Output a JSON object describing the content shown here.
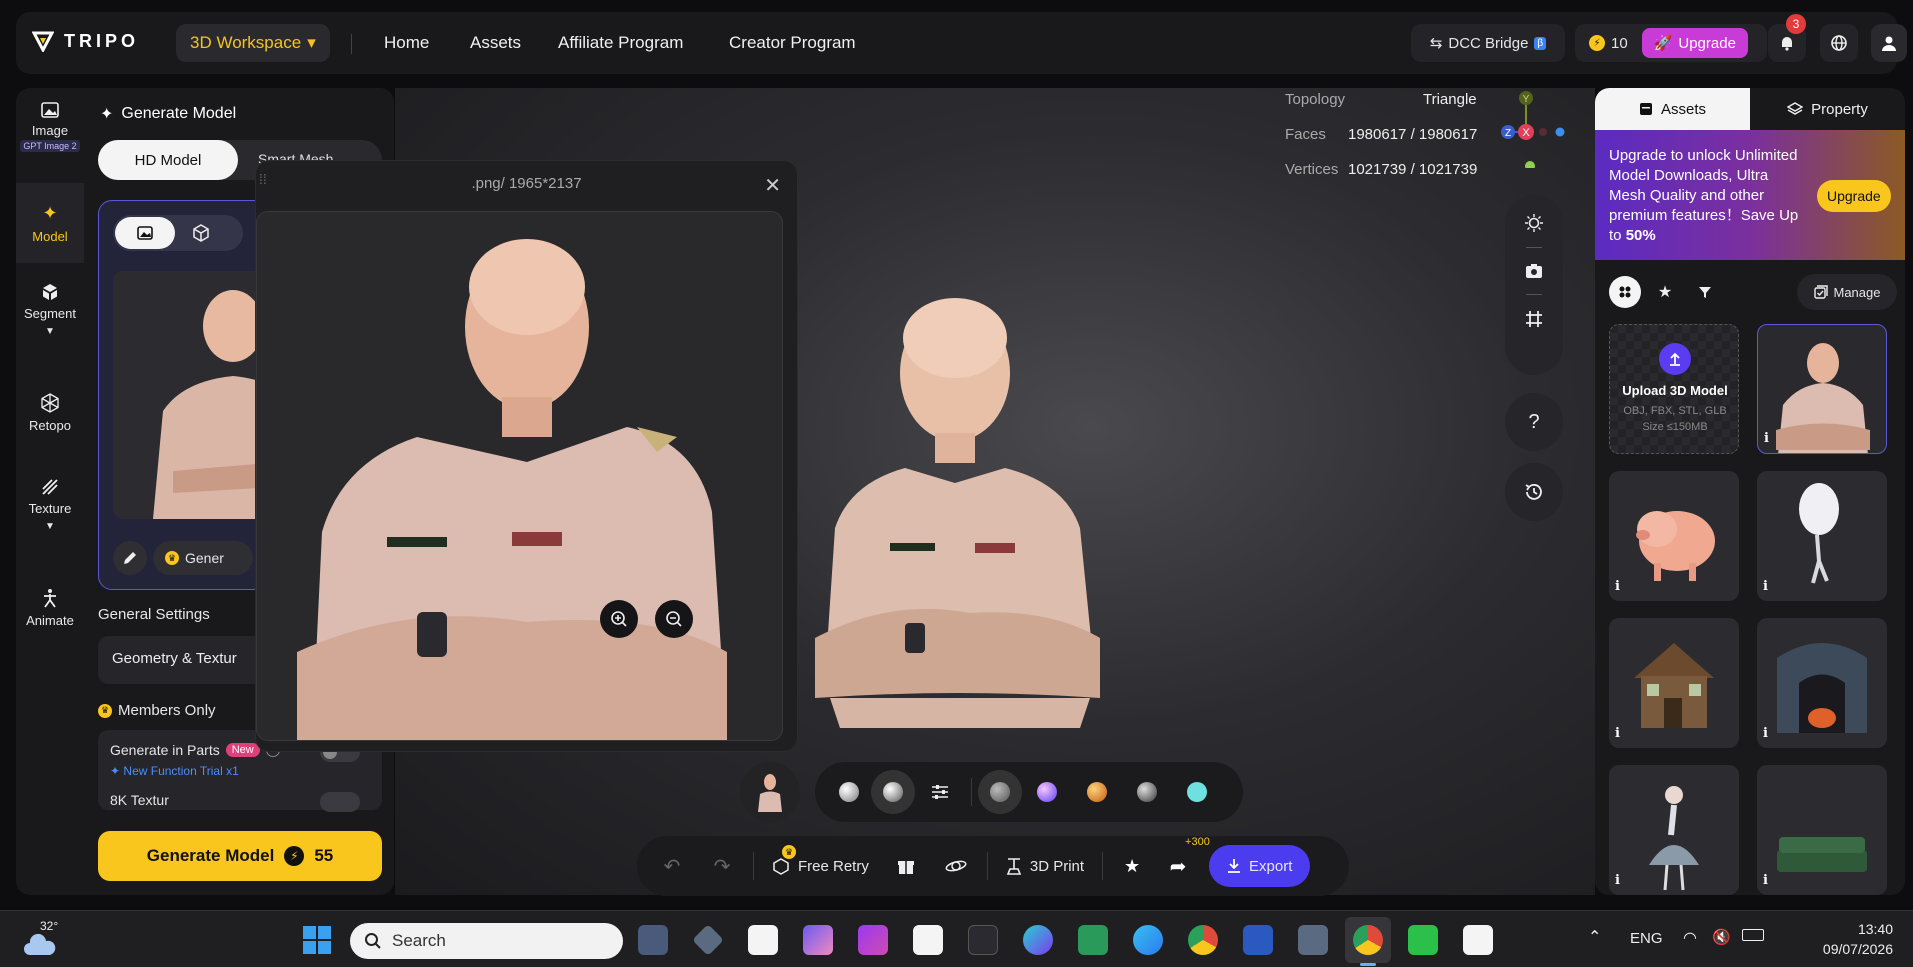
{
  "topbar": {
    "brand": "TRIPO",
    "workspace": "3D Workspace",
    "nav": [
      "Home",
      "Assets",
      "Affiliate Program",
      "Creator Program"
    ],
    "dcc_bridge": "DCC Bridge",
    "dcc_badge": "β",
    "credits": "10",
    "upgrade": "Upgrade",
    "notifications": "3"
  },
  "rail": {
    "image": "Image",
    "image_badge": "GPT Image 2",
    "model": "Model",
    "segment": "Segment",
    "retopo": "Retopo",
    "texture": "Texture",
    "animate": "Animate"
  },
  "gen_panel": {
    "title": "Generate Model",
    "tab_hd": "HD Model",
    "tab_smart": "Smart Mesh",
    "gener_label": "Gener",
    "general_settings": "General Settings",
    "geometry": "Geometry & Textur",
    "members_only": "Members Only",
    "generate_in_parts": "Generate in Parts",
    "new_badge": "New",
    "new_function": "New Function Trial x1",
    "k8": "8K Textur",
    "generate_button": "Generate Model",
    "generate_cost": "55"
  },
  "viewport": {
    "topology_label": "Topology",
    "topology_value": "Triangle",
    "faces_label": "Faces",
    "faces_value": "1980617 / 1980617",
    "vertices_label": "Vertices",
    "vertices_value": "1021739 / 1021739",
    "axis_y": "Y",
    "axis_x": "X",
    "axis_z": "Z"
  },
  "popup": {
    "title": ".png/ 1965*2137"
  },
  "bottom_toolbar": {
    "free_retry": "Free Retry",
    "print": "3D Print",
    "share_bonus": "+300",
    "export": "Export"
  },
  "right_panel": {
    "tab_assets": "Assets",
    "tab_property": "Property",
    "banner_text_1": "Upgrade to unlock Unlimited Model Downloads, Ultra Mesh Quality and other premium features！Save Up to ",
    "banner_text_2": "50%",
    "banner_button": "Upgrade",
    "manage": "Manage",
    "upload_title": "Upload 3D Model",
    "upload_formats": "OBJ, FBX, STL, GLB",
    "upload_size": "Size ≤150MB",
    "info": "i"
  },
  "taskbar": {
    "weather": "32°",
    "search": "Search",
    "language": "ENG",
    "time": "13:40",
    "date": "09/07/2026"
  },
  "colors": {
    "accent_yellow": "#f8c61c",
    "accent_purple": "#5b58d6",
    "upgrade_pink": "#c93bd6",
    "export_blue": "#4b3cf0"
  }
}
